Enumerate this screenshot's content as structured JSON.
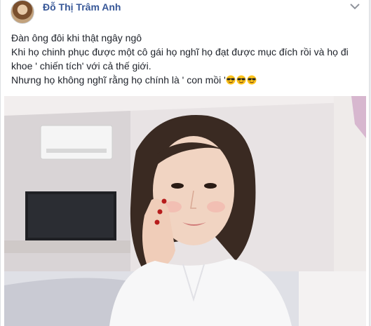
{
  "post": {
    "author": "Đỗ Thị Trâm Anh",
    "lines": [
      "Đàn ông đôi khi thật ngây ngô",
      "Khi họ chinh phục được một cô gái họ nghĩ họ đạt được mục đích rồi và họ đi",
      "khoe ' chiến tích' với cả thế giới.",
      "Nhưng họ không nghĩ rằng họ chính là ' con mồi '"
    ],
    "emojis": [
      "smiling-face-with-sunglasses",
      "smiling-face-with-sunglasses",
      "smiling-face-with-sunglasses"
    ],
    "photo": "selfie-of-woman-in-bedroom"
  },
  "icons": {
    "options": "chevron-down-icon"
  },
  "colors": {
    "author": "#385898",
    "text": "#1d2129",
    "background": "#e9ebee"
  }
}
